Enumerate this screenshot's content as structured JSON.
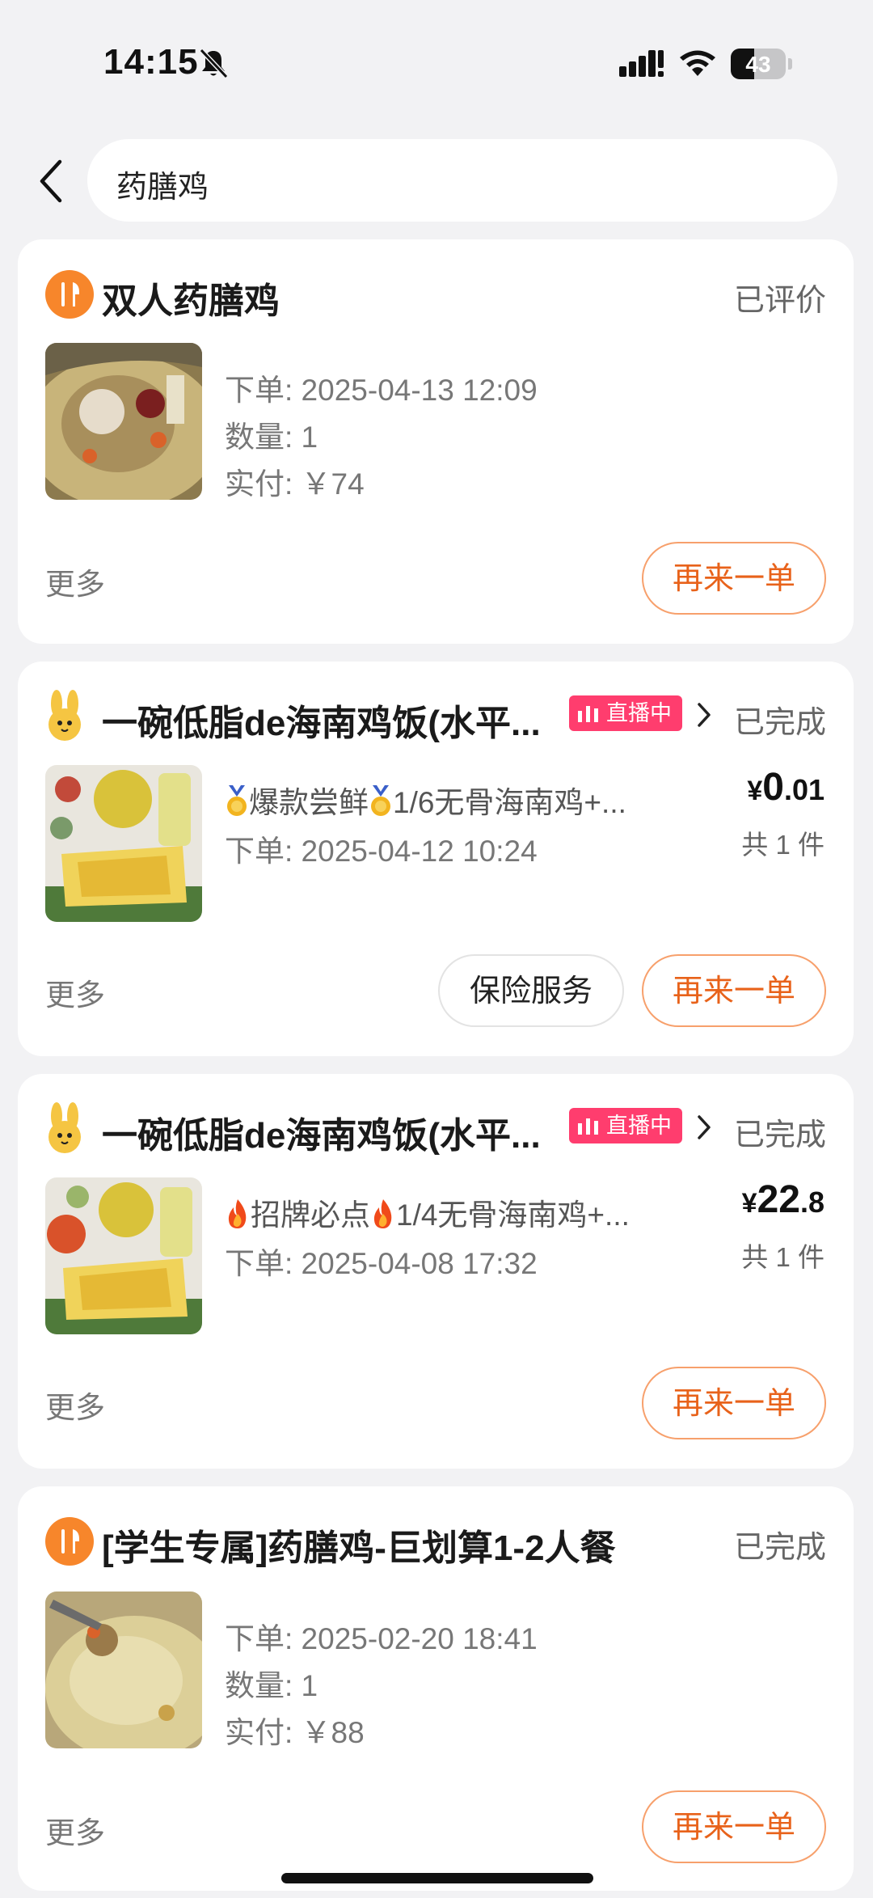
{
  "status_bar": {
    "time": "14:15",
    "battery": "43"
  },
  "search": {
    "query": "药膳鸡"
  },
  "orders": [
    {
      "shop_name": "双人药膳鸡",
      "status": "已评价",
      "order_time": "下单: 2025-04-13 12:09",
      "quantity": "数量: 1",
      "paid": "实付: ￥74",
      "more": "更多",
      "reorder": "再来一单"
    },
    {
      "shop_name": "一碗低脂de海南鸡饭(水平...",
      "live_badge": "直播中",
      "status": "已完成",
      "product_prefix": "爆款尝鲜",
      "product_rest": "1/6无骨海南鸡+...",
      "order_time": "下单: 2025-04-12 10:24",
      "price_symbol": "¥",
      "price_int": "0",
      "price_dec": ".01",
      "item_count": "共 1 件",
      "more": "更多",
      "insurance": "保险服务",
      "reorder": "再来一单"
    },
    {
      "shop_name": "一碗低脂de海南鸡饭(水平...",
      "live_badge": "直播中",
      "status": "已完成",
      "product_prefix": "招牌必点",
      "product_rest": "1/4无骨海南鸡+...",
      "order_time": "下单: 2025-04-08 17:32",
      "price_symbol": "¥",
      "price_int": "22",
      "price_dec": ".8",
      "item_count": "共 1 件",
      "more": "更多",
      "reorder": "再来一单"
    },
    {
      "shop_name": "[学生专属]药膳鸡-巨划算1-2人餐",
      "status": "已完成",
      "order_time": "下单: 2025-02-20 18:41",
      "quantity": "数量: 1",
      "paid": "实付: ￥88",
      "more": "更多",
      "reorder": "再来一单"
    }
  ],
  "colors": {
    "accent": "#e8621a",
    "meituan_orange": "#f7862b",
    "live_pink": "#ff3d6e",
    "background": "#f2f2f4"
  }
}
